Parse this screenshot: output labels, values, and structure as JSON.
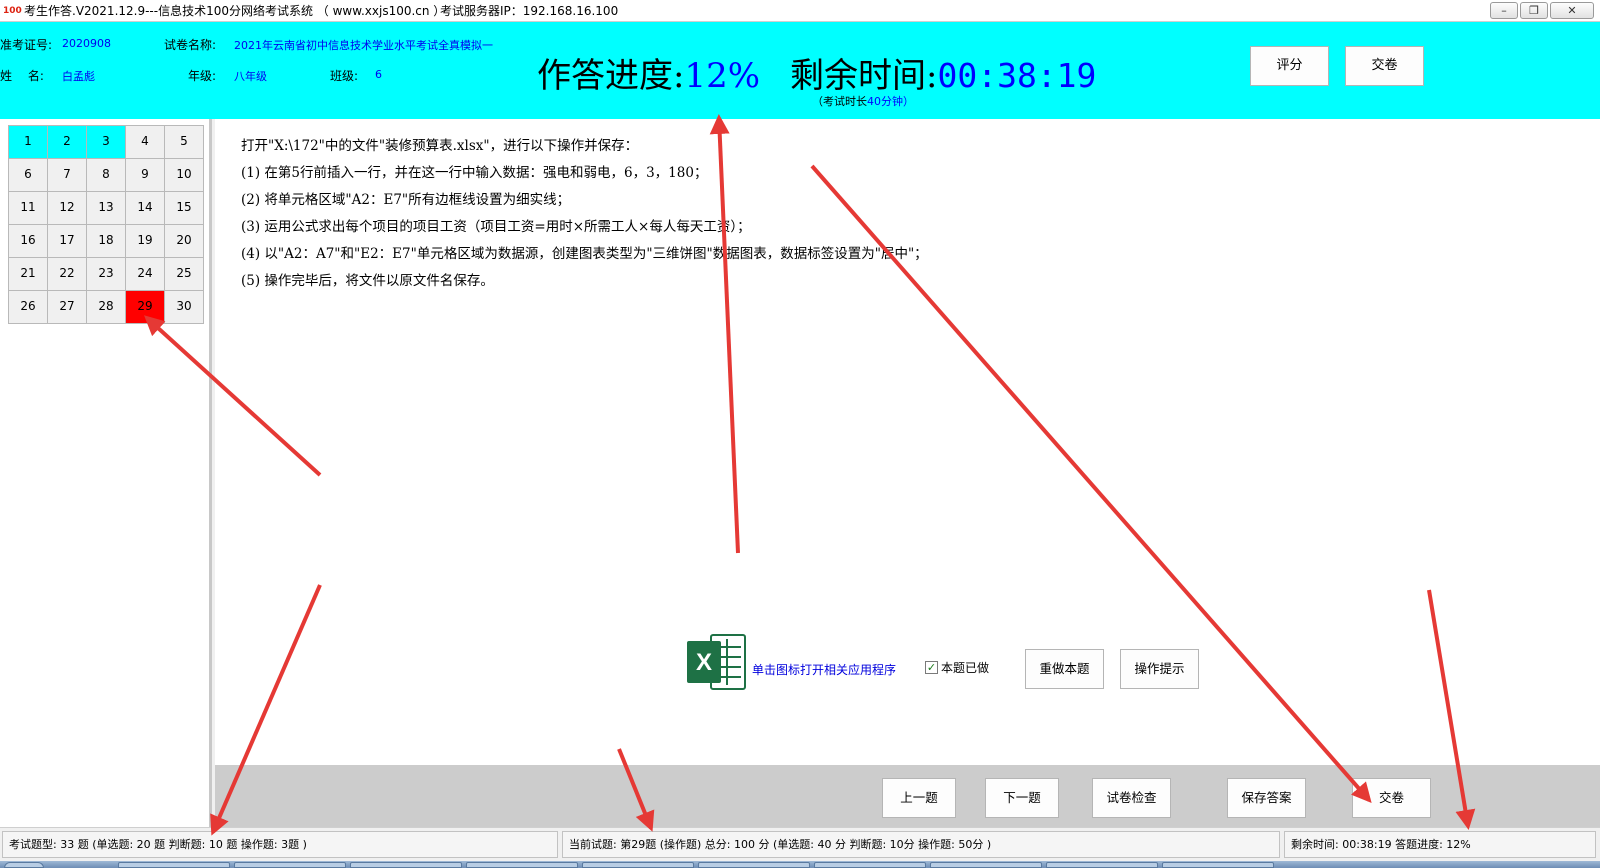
{
  "window": {
    "title": "考生作答.V2021.12.9---信息技术100分网络考试系统 （ www.xxjs100.cn ）",
    "server_label": "考试服务器IP：192.168.16.100",
    "minimize": "–",
    "restore": "❐",
    "close": "✕"
  },
  "header": {
    "ticket_label": "准考证号:",
    "ticket_value": "2020908",
    "paper_label": "试卷名称:",
    "paper_value": "2021年云南省初中信息技术学业水平考试全真模拟一",
    "name_label": "姓　 名:",
    "name_value": "白孟彪",
    "grade_label": "年级:",
    "grade_value": "八年级",
    "class_label": "班级:",
    "class_value": "6",
    "progress_label": "作答进度:",
    "progress_value": "12%",
    "time_label": "剩余时间:",
    "time_value": "00:38:19",
    "duration_prefix": "（考试时长",
    "duration_value": "40分钟）",
    "score_button": "评分",
    "submit_button": "交卷"
  },
  "questions": {
    "items": [
      "1",
      "2",
      "3",
      "4",
      "5",
      "6",
      "7",
      "8",
      "9",
      "10",
      "11",
      "12",
      "13",
      "14",
      "15",
      "16",
      "17",
      "18",
      "19",
      "20",
      "21",
      "22",
      "23",
      "24",
      "25",
      "26",
      "27",
      "28",
      "29",
      "30"
    ],
    "done": [
      1,
      2,
      3
    ],
    "current": 29
  },
  "question": {
    "lines": [
      "打开\"X:\\172\"中的文件\"装修预算表.xlsx\"，进行以下操作并保存：",
      "(1) 在第5行前插入一行，并在这一行中输入数据：强电和弱电，6，3，180；",
      "(2) 将单元格区域\"A2：E7\"所有边框线设置为细实线；",
      "(3) 运用公式求出每个项目的项目工资（项目工资=用时×所需工人×每人每天工资）；",
      "(4) 以\"A2：A7\"和\"E2：E7\"单元格区域为数据源，创建图表类型为\"三维饼图\"数据图表，数据标签设置为\"居中\"；",
      "(5) 操作完毕后，将文件以原文件名保存。"
    ],
    "open_app_text": "单击图标打开相关应用程序",
    "done_checkbox_label": "本题已做",
    "redo_button": "重做本题",
    "hint_button": "操作提示",
    "excel_icon": "excel-icon"
  },
  "nav": {
    "prev": "上一题",
    "next": "下一题",
    "check": "试卷检查",
    "save": "保存答案",
    "submit": "交卷"
  },
  "status": {
    "summary": "考试题型: 33 题 (单选题: 20 题 判断题: 10 题 操作题: 3题 )",
    "current": "当前试题: 第29题 (操作题) 总分: 100 分 (单选题: 40 分 判断题: 10分 操作题: 50分 )",
    "time_progress": "剩余时间: 00:38:19 答题进度: 12%"
  },
  "colors": {
    "header_bg": "#00ffff",
    "done_cell": "#00ffff",
    "current_cell": "#ff0000",
    "accent_text": "#0000ff",
    "arrow": "#e53935"
  }
}
